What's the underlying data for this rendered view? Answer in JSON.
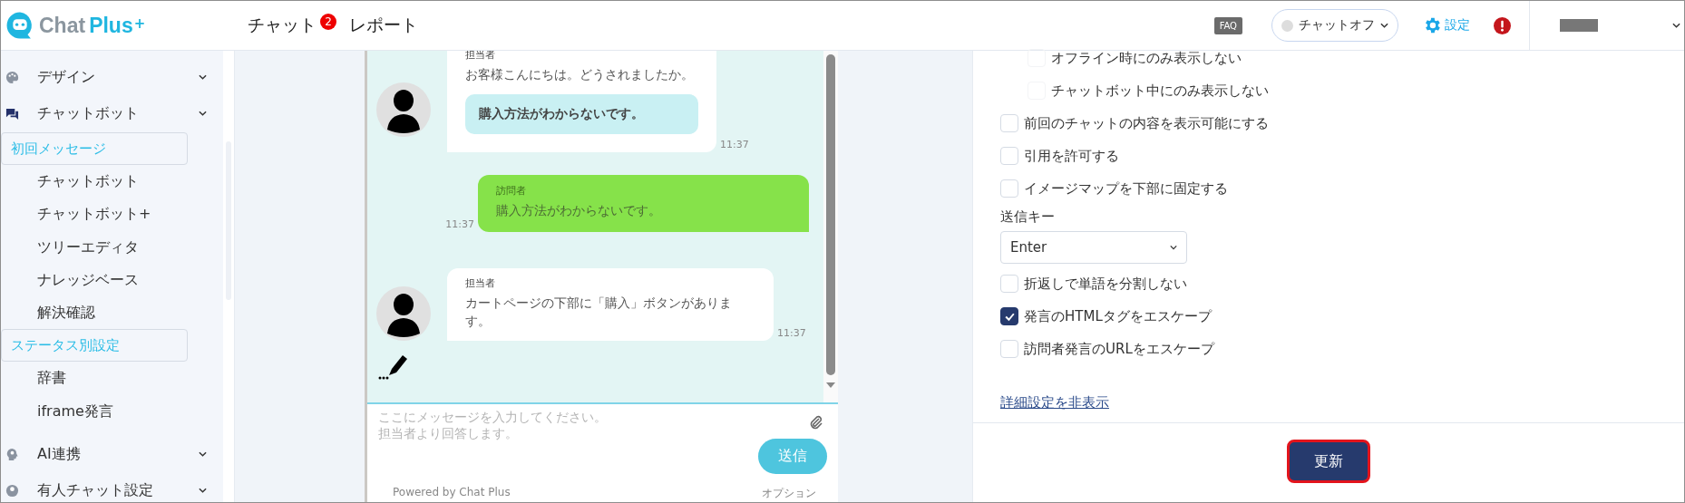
{
  "header": {
    "logo": {
      "word1": "Chat",
      "word2": "Plus",
      "mark": "+"
    },
    "nav": [
      {
        "label": "チャット",
        "badge": "2"
      },
      {
        "label": "レポート"
      }
    ],
    "faq": "FAQ",
    "status": {
      "label": "チャットオフ",
      "on": false
    },
    "settings": "設定"
  },
  "sidebar": {
    "items": [
      {
        "label": "デザイン"
      },
      {
        "label": "チャットボット",
        "children": [
          {
            "label": "初回メッセージ",
            "selected": true
          },
          {
            "label": "チャットボット",
            "selected": false
          },
          {
            "label": "チャットボット+",
            "selected": false
          },
          {
            "label": "ツリーエディタ",
            "selected": false
          },
          {
            "label": "ナレッジベース",
            "selected": false
          },
          {
            "label": "解決確認",
            "selected": false
          },
          {
            "label": "ステータス別設定",
            "selected": true
          },
          {
            "label": "辞書",
            "selected": false
          },
          {
            "label": "iframe発言",
            "selected": false
          }
        ]
      },
      {
        "label": "AI連携"
      },
      {
        "label": "有人チャット設定"
      }
    ]
  },
  "chat": {
    "messages": [
      {
        "kind": "agent",
        "name": "担当者",
        "text": "お客様こんにちは。どうされましたか。",
        "quick_reply": "購入方法がわからないです。",
        "time": "11:37"
      },
      {
        "kind": "visitor",
        "name": "訪問者",
        "text": "購入方法がわからないです。",
        "time": "11:37"
      },
      {
        "kind": "agent",
        "name": "担当者",
        "text": "カートページの下部に「購入」ボタンがあります。",
        "time": "11:37"
      }
    ],
    "typing": true,
    "input": {
      "placeholder": "ここにメッセージを入力してください。担当者より回答します。"
    },
    "send": "送信",
    "footer_left": "Powered by Chat Plus",
    "footer_right": "オプション"
  },
  "settings": {
    "options": [
      {
        "kind": "sub_checkbox",
        "label": "オフライン時にのみ表示しない",
        "checked": false
      },
      {
        "kind": "sub_checkbox",
        "label": "チャットボット中にのみ表示しない",
        "checked": false
      },
      {
        "kind": "checkbox",
        "label": "前回のチャットの内容を表示可能にする",
        "checked": false
      },
      {
        "kind": "checkbox",
        "label": "引用を許可する",
        "checked": false
      },
      {
        "kind": "checkbox",
        "label": "イメージマップを下部に固定する",
        "checked": false
      },
      {
        "kind": "select",
        "label": "送信キー",
        "value": "Enter"
      },
      {
        "kind": "checkbox",
        "label": "折返しで単語を分割しない",
        "checked": false
      },
      {
        "kind": "checkbox",
        "label": "発言のHTMLタグをエスケープ",
        "checked": true
      },
      {
        "kind": "checkbox",
        "label": "訪問者発言のURLをエスケープ",
        "checked": false
      }
    ],
    "link": "詳細設定を非表示",
    "button": "更新"
  }
}
